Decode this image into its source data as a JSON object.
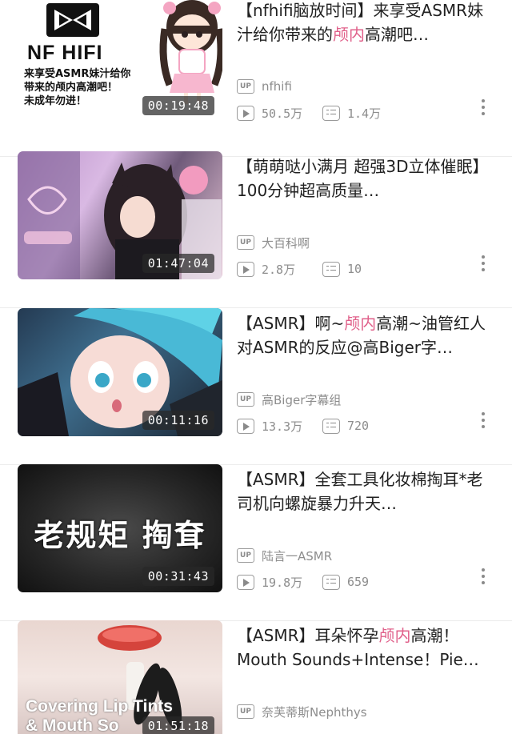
{
  "items": [
    {
      "title": "【nfhifi脑放时间】来享受ASMR妹汁给你带来的颅内高潮吧…",
      "title_parts": [
        "【nfhifi脑放时间】来享受ASMR妹汁给你带来的",
        "颅内",
        "高潮吧…"
      ],
      "uploader": "nfhifi",
      "views": "50.5万",
      "danmaku": "1.4万",
      "duration": "00:19:48",
      "thumb_logo": "NF HIFI",
      "thumb_caption_lines": [
        "来享受ASMR妹汁给你",
        "带来的颅内高潮吧！",
        "未成年勿进！"
      ]
    },
    {
      "title": "【萌萌哒小满月 超强3D立体催眠】100分钟超高质量…",
      "title_parts": [
        "【萌萌哒小满月 超强3D立体催眠】100分钟超高质量…",
        "",
        ""
      ],
      "uploader": "大百科啊",
      "views": "2.8万",
      "danmaku": "10",
      "duration": "01:47:04"
    },
    {
      "title": "【ASMR】啊~颅内高潮~油管红人对ASMR的反应@高Biger字…",
      "title_parts": [
        "【ASMR】啊~",
        "颅内",
        "高潮~油管红人对ASMR的反应@高Biger字…"
      ],
      "uploader": "高Biger字幕组",
      "views": "13.3万",
      "danmaku": "720",
      "duration": "00:11:16"
    },
    {
      "title": "【ASMR】全套工具化妆棉掏耳*老司机向螺旋暴力升天…",
      "title_parts": [
        "【ASMR】全套工具化妆棉掏耳*老司机向螺旋暴力升天…",
        "",
        ""
      ],
      "uploader": "陆言一ASMR",
      "views": "19.8万",
      "danmaku": "659",
      "duration": "00:31:43",
      "thumb_text": "老规矩 掏耷"
    },
    {
      "title": "【ASMR】耳朵怀孕颅内高潮！Mouth Sounds+Intense！Pie…",
      "title_parts": [
        "【ASMR】耳朵怀孕",
        "颅内",
        "高潮！Mouth Sounds+Intense！Pie…"
      ],
      "uploader": "奈芙蒂斯Nephthys",
      "views": "",
      "danmaku": "",
      "duration": "01:51:18",
      "thumb_text_lines": [
        "Covering Lip Tints",
        "& Mouth So"
      ]
    }
  ],
  "labels": {
    "up_badge": "UP"
  },
  "icons": {
    "play": "play-count-icon",
    "danmaku": "danmaku-icon",
    "more": "more-vertical-icon",
    "up": "up-badge-icon"
  },
  "colors": {
    "highlight": "#e0608a",
    "meta": "#8d8d8d",
    "title": "#212121"
  }
}
